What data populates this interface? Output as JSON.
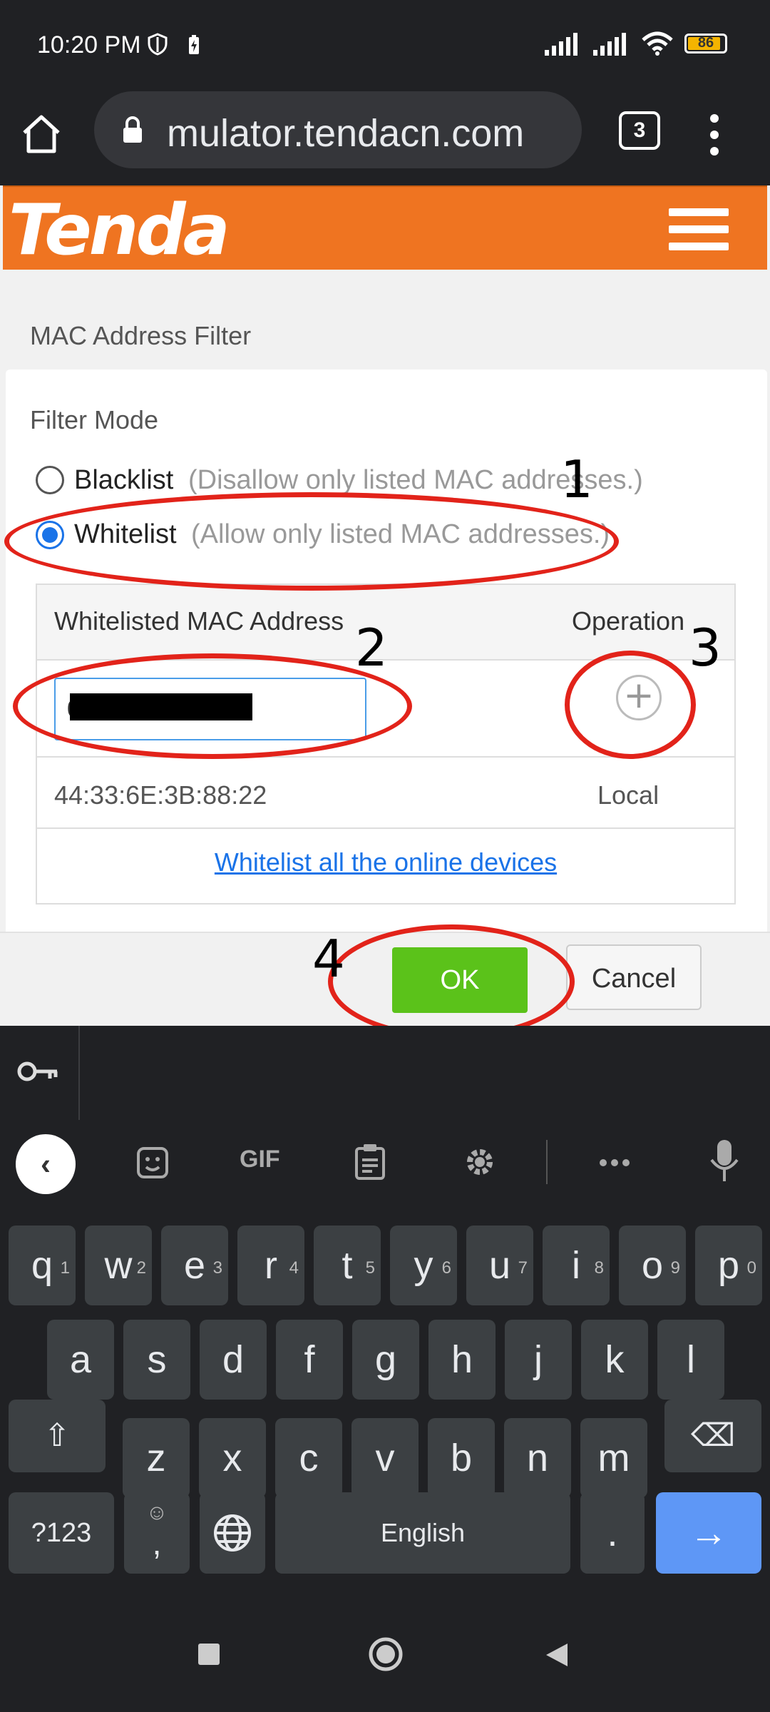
{
  "status_bar": {
    "time": "10:20 PM",
    "battery": "86",
    "battery_fraction": 0.86
  },
  "browser": {
    "url": "mulator.tendacn.com",
    "tab_count": "3"
  },
  "router": {
    "brand": "Tenda"
  },
  "page": {
    "title": "MAC Address Filter",
    "filter_mode_label": "Filter Mode",
    "options": [
      {
        "label": "Blacklist",
        "desc": "(Disallow only listed MAC addresses.)",
        "selected": false
      },
      {
        "label": "Whitelist",
        "desc": "(Allow only listed MAC addresses.)",
        "selected": true
      }
    ],
    "table": {
      "col_mac": "Whitelisted MAC Address",
      "col_operation": "Operation",
      "input_value": "0                    4",
      "add_symbol": "+",
      "rows": [
        {
          "mac": "44:33:6E:3B:88:22",
          "operation": "Local"
        }
      ],
      "link": "Whitelist all the online devices"
    },
    "ok_label": "OK",
    "cancel_label": "Cancel"
  },
  "annotations": [
    "1",
    "2",
    "3",
    "4"
  ],
  "keyboard": {
    "toolbar": {
      "gif": "GIF"
    },
    "row1": [
      {
        "k": "q",
        "s": "1"
      },
      {
        "k": "w",
        "s": "2"
      },
      {
        "k": "e",
        "s": "3"
      },
      {
        "k": "r",
        "s": "4"
      },
      {
        "k": "t",
        "s": "5"
      },
      {
        "k": "y",
        "s": "6"
      },
      {
        "k": "u",
        "s": "7"
      },
      {
        "k": "i",
        "s": "8"
      },
      {
        "k": "o",
        "s": "9"
      },
      {
        "k": "p",
        "s": "0"
      }
    ],
    "row2": [
      "a",
      "s",
      "d",
      "f",
      "g",
      "h",
      "j",
      "k",
      "l"
    ],
    "row3": [
      "z",
      "x",
      "c",
      "v",
      "b",
      "n",
      "m"
    ],
    "symbols_key": "?123",
    "comma_key": ",",
    "emoji_hint": "☺",
    "space_label": "English",
    "period_key": ".",
    "enter_symbol": "→",
    "shift_symbol": "⇧",
    "backspace_symbol": "⌫"
  },
  "colors": {
    "tenda_orange": "#ef7421",
    "ok_green": "#5bc21a",
    "annotation_red": "#e2231a",
    "radio_blue": "#1a73e8"
  }
}
